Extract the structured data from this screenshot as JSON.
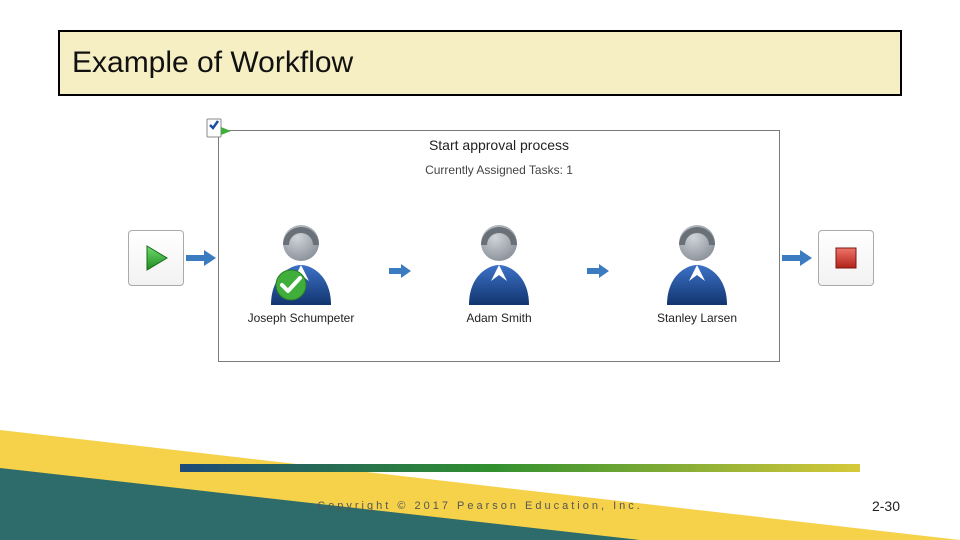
{
  "slide": {
    "title": "Example of Workflow",
    "copyright": "Copyright © 2017 Pearson Education, Inc.",
    "page_number": "2-30"
  },
  "workflow": {
    "box_title": "Start approval process",
    "box_subtitle": "Currently Assigned Tasks: 1",
    "start_icon": "play-icon",
    "stop_icon": "stop-icon",
    "people": [
      {
        "name": "Joseph Schumpeter",
        "status": "approved"
      },
      {
        "name": "Adam Smith",
        "status": "pending"
      },
      {
        "name": "Stanley Larsen",
        "status": "pending"
      }
    ]
  },
  "colors": {
    "title_bg": "#f7efc4",
    "accent_yellow": "#f5d24a",
    "accent_teal": "#2e6b6b",
    "play_green": "#2fa82f",
    "stop_red": "#d33b2f",
    "person_blue": "#1d4f9e",
    "arrow_blue": "#3b7bbf",
    "check_green": "#3fae3b"
  }
}
